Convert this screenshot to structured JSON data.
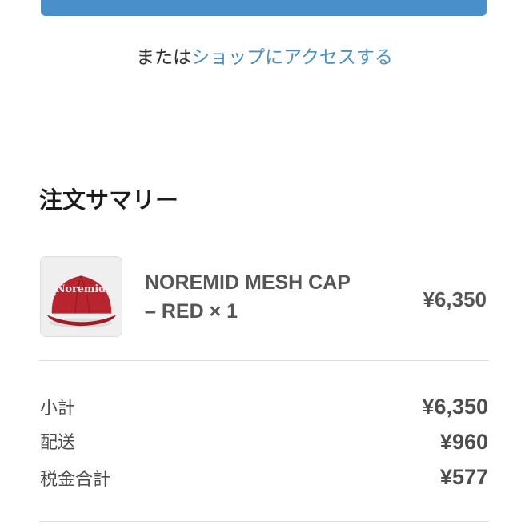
{
  "header": {
    "or_prefix": "または",
    "shop_link": "ショップにアクセスする"
  },
  "summary": {
    "title": "注文サマリー"
  },
  "product": {
    "name_line1": "NOREMID MESH CAP",
    "name_line2": "– RED × 1",
    "price": "¥6,350",
    "thumbnail_icon": "red-cap-image",
    "cap_color": "#b8252f",
    "cap_text": "Noremid"
  },
  "totals": {
    "rows": [
      {
        "label": "小計",
        "value": "¥6,350"
      },
      {
        "label": "配送",
        "value": "¥960"
      },
      {
        "label": "税金合計",
        "value": "¥577"
      }
    ]
  },
  "colors": {
    "primary_button": "#4a90c8",
    "link": "#4a8fc0"
  }
}
